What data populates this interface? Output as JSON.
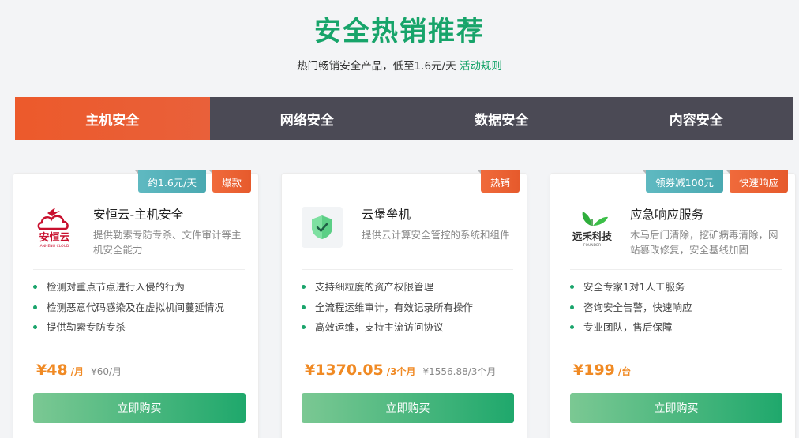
{
  "header": {
    "title": "安全热销推荐",
    "subtitle": "热门畅销安全产品，低至1.6元/天",
    "rules_link": "活动规则"
  },
  "tabs": [
    {
      "label": "主机安全",
      "active": true
    },
    {
      "label": "网络安全",
      "active": false
    },
    {
      "label": "数据安全",
      "active": false
    },
    {
      "label": "内容安全",
      "active": false
    }
  ],
  "cards": [
    {
      "badges": [
        {
          "text": "约1.6元/天",
          "color": "teal"
        },
        {
          "text": "爆款",
          "color": "orange"
        }
      ],
      "logo": "anheng-cloud-logo",
      "logo_text": "ANHENG CLOUD",
      "name": "安恒云-主机安全",
      "desc": "提供勒索专防专杀、文件审计等主机安全能力",
      "features": [
        "检测对重点节点进行入侵的行为",
        "检测恶意代码感染及在虚拟机间蔓延情况",
        "提供勒索专防专杀"
      ],
      "price": "¥48",
      "unit": "/月",
      "old_price": "¥60/月",
      "buy_label": "立即购买"
    },
    {
      "badges": [
        {
          "text": "热销",
          "color": "orange"
        }
      ],
      "logo": "shield-check-icon",
      "name": "云堡垒机",
      "desc": "提供云计算安全管控的系统和组件",
      "features": [
        "支持细粒度的资产权限管理",
        "全流程运维审计，有效记录所有操作",
        "高效运维，支持主流访问协议"
      ],
      "price": "¥1370.05",
      "unit": "/3个月",
      "old_price": "¥1556.88/3个月",
      "buy_label": "立即购买"
    },
    {
      "badges": [
        {
          "text": "领券减100元",
          "color": "teal"
        },
        {
          "text": "快速响应",
          "color": "orange"
        }
      ],
      "logo": "yuanhe-tech-logo",
      "logo_text": "远禾科技",
      "logo_subtext": "FOUNDER",
      "name": "应急响应服务",
      "desc": "木马后门清除，挖矿病毒清除，网站篡改修复，安全基线加固",
      "features": [
        "安全专家1对1人工服务",
        "咨询安全告警，快速响应",
        "专业团队，售后保障"
      ],
      "price": "¥199",
      "unit": "/台",
      "old_price": "",
      "buy_label": "立即购买"
    }
  ],
  "colors": {
    "brand_green": "#17a46a",
    "orange": "#ec5a2b",
    "price": "#f08a24",
    "tab_bg": "#4b4a55"
  }
}
